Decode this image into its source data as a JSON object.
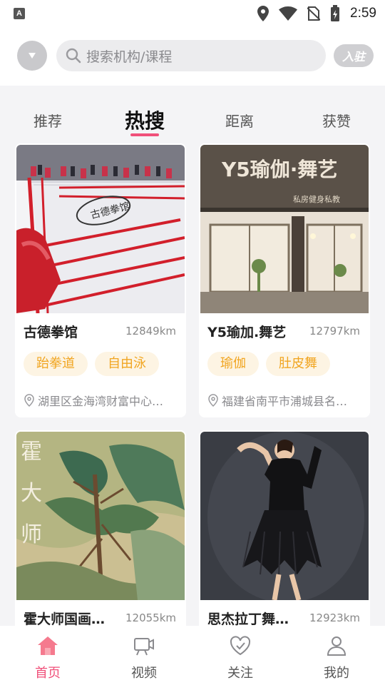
{
  "status_bar": {
    "time": "2:59",
    "notification_icon": "A"
  },
  "header": {
    "search_placeholder": "搜索机构/课程",
    "join_label": "入驻"
  },
  "tabs": [
    {
      "label": "推荐",
      "active": false
    },
    {
      "label": "热搜",
      "active": true
    },
    {
      "label": "距离",
      "active": false
    },
    {
      "label": "获赞",
      "active": false
    }
  ],
  "cards": [
    {
      "name": "古德拳馆",
      "distance": "12849km",
      "tags": [
        "跆拳道",
        "自由泳"
      ],
      "address": "湖里区金海湾财富中心…"
    },
    {
      "name": "Y5瑜加.舞艺",
      "distance": "12797km",
      "tags": [
        "瑜伽",
        "肚皮舞"
      ],
      "address": "福建省南平市浦城县名…"
    },
    {
      "name": "霍大师国画…",
      "distance": "12055km",
      "tags": [],
      "address": "",
      "image_text": "霍大师"
    },
    {
      "name": "思杰拉丁舞…",
      "distance": "12923km",
      "tags": [],
      "address": ""
    }
  ],
  "card_images": {
    "card2_sign": "Y5瑜伽·舞艺",
    "card2_subsign": "私房健身私教"
  },
  "nav": [
    {
      "label": "首页",
      "icon": "home-icon",
      "active": true
    },
    {
      "label": "视频",
      "icon": "video-icon",
      "active": false
    },
    {
      "label": "关注",
      "icon": "heart-icon",
      "active": false
    },
    {
      "label": "我的",
      "icon": "user-icon",
      "active": false
    }
  ],
  "colors": {
    "accent": "#f0507a",
    "tag_text": "#f1a520",
    "tag_bg": "#fdf4e3"
  }
}
